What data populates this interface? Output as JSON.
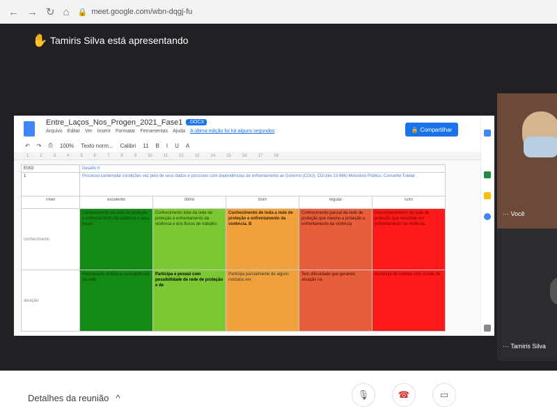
{
  "browser": {
    "url": "meet.google.com/wbn-dqgj-fu"
  },
  "presenter": {
    "text": "Tamiris Silva está apresentando"
  },
  "doc": {
    "title": "Entre_Laços_Nos_Progen_2021_Fase1",
    "badge": ".DOCX",
    "menu": [
      "Arquivo",
      "Editar",
      "Ver",
      "Inserir",
      "Formatar",
      "Ferramentas",
      "Ajuda"
    ],
    "last_edit": "A última edição foi há alguns segundos",
    "share_label": "Compartilhar",
    "zoom": "100%",
    "style": "Texto norm...",
    "font": "Calibri",
    "font_size": "11"
  },
  "table": {
    "row1": {
      "label": "EIXO",
      "value": "Desafio II"
    },
    "row2": {
      "label": "1",
      "value": "Processo contemplar condições vez pelo de seus dados e possíveis com dependências de enfrentamento ao Governo (CGU), CGU(lei 13 666) Ministério Público, Conselho Tutelar"
    },
    "headers": [
      "nível",
      "excelente",
      "ótimo",
      "bom",
      "regular",
      "ruim"
    ],
    "rows": [
      {
        "label": "conhecimento",
        "cells": [
          "Conhecimento da rede de proteção e enfrentamento da violência e seus fluxos",
          "Conhecimento total da rede de proteção e enfrentamento da violência e dos fluxos de trabalho",
          "Conhecimento de toda a rede de proteção e enfrentamento da violência. B",
          "Conhecimento parcial da rede de proteção que mesmo a proteção e enfrentamento da violência",
          "Desconhecimento da rede de proteção que resultado em enfrentamento da violência"
        ]
      },
      {
        "label": "atuação",
        "cells": [
          "Participação efetiva e compartilhada da rede",
          "Participa e possui com possibilidade de rede de proteção e de",
          "Participa parcialmente de alguns módulos em",
          "Tem dificuldade que gerando atuação na",
          "Ausência de contato com a rede de"
        ]
      }
    ]
  },
  "participants": [
    {
      "name": "Você"
    },
    {
      "name": "Tamiris Silva"
    }
  ],
  "bottom": {
    "details_label": "Detalhes da reunião"
  },
  "colors": {
    "meet_bg": "#202124",
    "accent": "#1a73e8",
    "end_call": "#d93025"
  }
}
